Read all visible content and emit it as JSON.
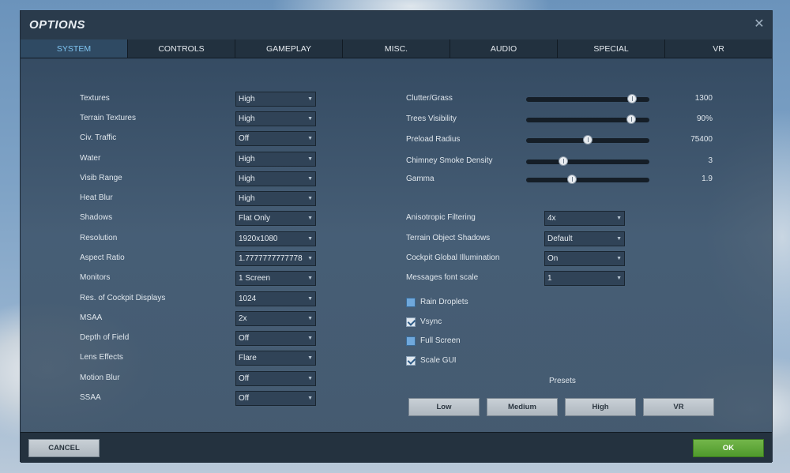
{
  "window": {
    "title": "OPTIONS"
  },
  "tabs": [
    {
      "label": "SYSTEM",
      "active": true
    },
    {
      "label": "CONTROLS"
    },
    {
      "label": "GAMEPLAY"
    },
    {
      "label": "MISC."
    },
    {
      "label": "AUDIO"
    },
    {
      "label": "SPECIAL"
    },
    {
      "label": "VR"
    }
  ],
  "left_settings": [
    {
      "label": "Textures",
      "value": "High"
    },
    {
      "label": "Terrain Textures",
      "value": "High"
    },
    {
      "label": "Civ. Traffic",
      "value": "Off"
    },
    {
      "label": "Water",
      "value": "High"
    },
    {
      "label": "Visib Range",
      "value": "High"
    },
    {
      "label": "Heat Blur",
      "value": "High"
    },
    {
      "label": "Shadows",
      "value": "Flat Only"
    },
    {
      "label": "Resolution",
      "value": "1920x1080"
    },
    {
      "label": "Aspect Ratio",
      "value": "1.7777777777778"
    },
    {
      "label": "Monitors",
      "value": "1 Screen"
    },
    {
      "label": "Res. of Cockpit Displays",
      "value": "1024"
    },
    {
      "label": "MSAA",
      "value": "2x"
    },
    {
      "label": "Depth of Field",
      "value": "Off"
    },
    {
      "label": "Lens Effects",
      "value": "Flare"
    },
    {
      "label": "Motion Blur",
      "value": "Off"
    },
    {
      "label": "SSAA",
      "value": "Off"
    }
  ],
  "sliders": [
    {
      "label": "Clutter/Grass",
      "value": "1300",
      "level": 0.86
    },
    {
      "label": "Trees Visibility",
      "value": "90%",
      "level": 0.85
    },
    {
      "label": "Preload Radius",
      "value": "75400",
      "level": 0.5
    },
    {
      "label": "Chimney Smoke Density",
      "value": "3",
      "level": 0.3
    },
    {
      "label": "Gamma",
      "value": "1.9",
      "level": 0.37
    }
  ],
  "right_dropdowns": [
    {
      "label": "Anisotropic Filtering",
      "value": "4x"
    },
    {
      "label": "Terrain Object Shadows",
      "value": "Default"
    },
    {
      "label": "Cockpit Global Illumination",
      "value": "On"
    },
    {
      "label": "Messages font scale",
      "value": "1"
    }
  ],
  "checkboxes": [
    {
      "label": "Rain Droplets",
      "checked": false
    },
    {
      "label": "Vsync",
      "checked": true
    },
    {
      "label": "Full Screen",
      "checked": false
    },
    {
      "label": "Scale GUI",
      "checked": true
    }
  ],
  "presets": {
    "title": "Presets",
    "buttons": [
      "Low",
      "Medium",
      "High",
      "VR"
    ]
  },
  "footer": {
    "cancel_label": "CANCEL",
    "ok_label": "OK"
  },
  "icons": {
    "close": "close-icon",
    "dropdown": "chevron-down-icon",
    "check": "checkmark-icon"
  },
  "colors": {
    "active_tab": "#7fc4f0",
    "ok_button": "#5ea63a",
    "checkbox": "#6fa8dc"
  }
}
